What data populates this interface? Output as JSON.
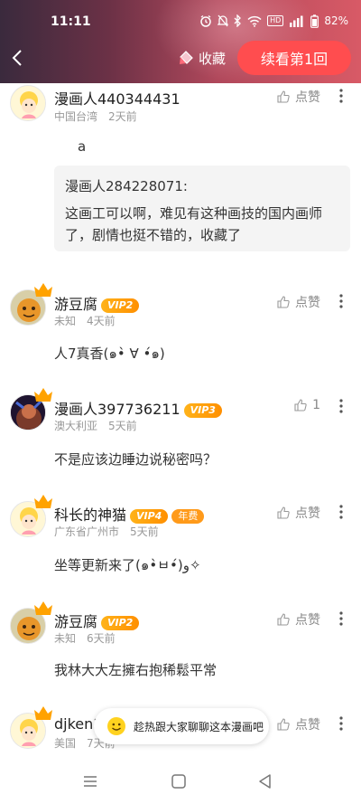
{
  "status_bar": {
    "time": "11:11",
    "battery": "82%",
    "hd_label": "HD",
    "signal_label": "5G"
  },
  "header": {
    "fav_label": "收藏",
    "continue_label": "续看第1回"
  },
  "comments": [
    {
      "user": "漫画人440344431",
      "region": "中国台湾",
      "time": "2天前",
      "like": "点赞",
      "text": "a",
      "quote": {
        "author": "漫画人284228071:",
        "text_line1": "这画工可以啊，难见有这种画技的国内画师",
        "text_line2": "了，剧情也挺不错的，收藏了"
      }
    },
    {
      "user": "游豆腐",
      "vip": "VIP2",
      "region": "未知",
      "time": "4天前",
      "like": "点赞",
      "text": "人7真香(๑•̀ ∀ •́๑)"
    },
    {
      "user": "漫画人397736211",
      "vip": "VIP3",
      "region": "澳大利亚",
      "time": "5天前",
      "like": "1",
      "text": "不是应该边睡边说秘密吗？"
    },
    {
      "user": "科长的神猫",
      "vip": "VIP4",
      "badge": "年费",
      "region": "广东省广州市",
      "time": "5天前",
      "like": "点赞",
      "text": "坐等更新来了(๑•̀ㅂ•́)و✧"
    },
    {
      "user": "游豆腐",
      "vip": "VIP2",
      "region": "未知",
      "time": "6天前",
      "like": "点赞",
      "text": "我林大大左擁右抱稀鬆平常"
    },
    {
      "user": "djken3",
      "region": "美国",
      "time": "7天前",
      "like": "点赞"
    }
  ],
  "chat_prompt": "趁热跟大家聊聊这本漫画吧",
  "colors": {
    "accent": "#ff4d4f",
    "vip": "#ffa200",
    "header_start": "#3a2a3d",
    "header_end": "#d85a66"
  },
  "icons": [
    "back-arrow-icon",
    "bookmark-icon",
    "thumb-up-icon",
    "more-vertical-icon",
    "crown-icon",
    "smiley-icon",
    "menu-icon",
    "home-square-icon",
    "back-triangle-icon"
  ]
}
